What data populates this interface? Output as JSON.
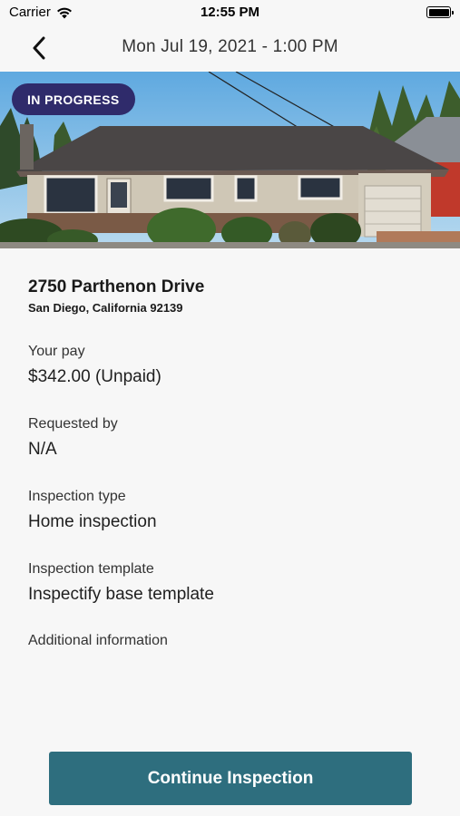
{
  "status_bar": {
    "carrier": "Carrier",
    "time": "12:55 PM"
  },
  "nav": {
    "title": "Mon Jul 19, 2021 - 1:00 PM",
    "back_icon": "chevron-left-icon"
  },
  "hero": {
    "status_badge": "IN PROGRESS",
    "badge_color": "#2f2b6b"
  },
  "address": {
    "line1": "2750 Parthenon Drive",
    "line2": "San Diego, California 92139"
  },
  "details": {
    "pay_label": "Your pay",
    "pay_value": "$342.00 (Unpaid)",
    "requested_label": "Requested by",
    "requested_value": "N/A",
    "type_label": "Inspection type",
    "type_value": "Home inspection",
    "template_label": "Inspection template",
    "template_value": "Inspectify base template",
    "additional_label": "Additional information"
  },
  "actions": {
    "continue_label": "Continue Inspection",
    "continue_color": "#2e6e7e"
  }
}
